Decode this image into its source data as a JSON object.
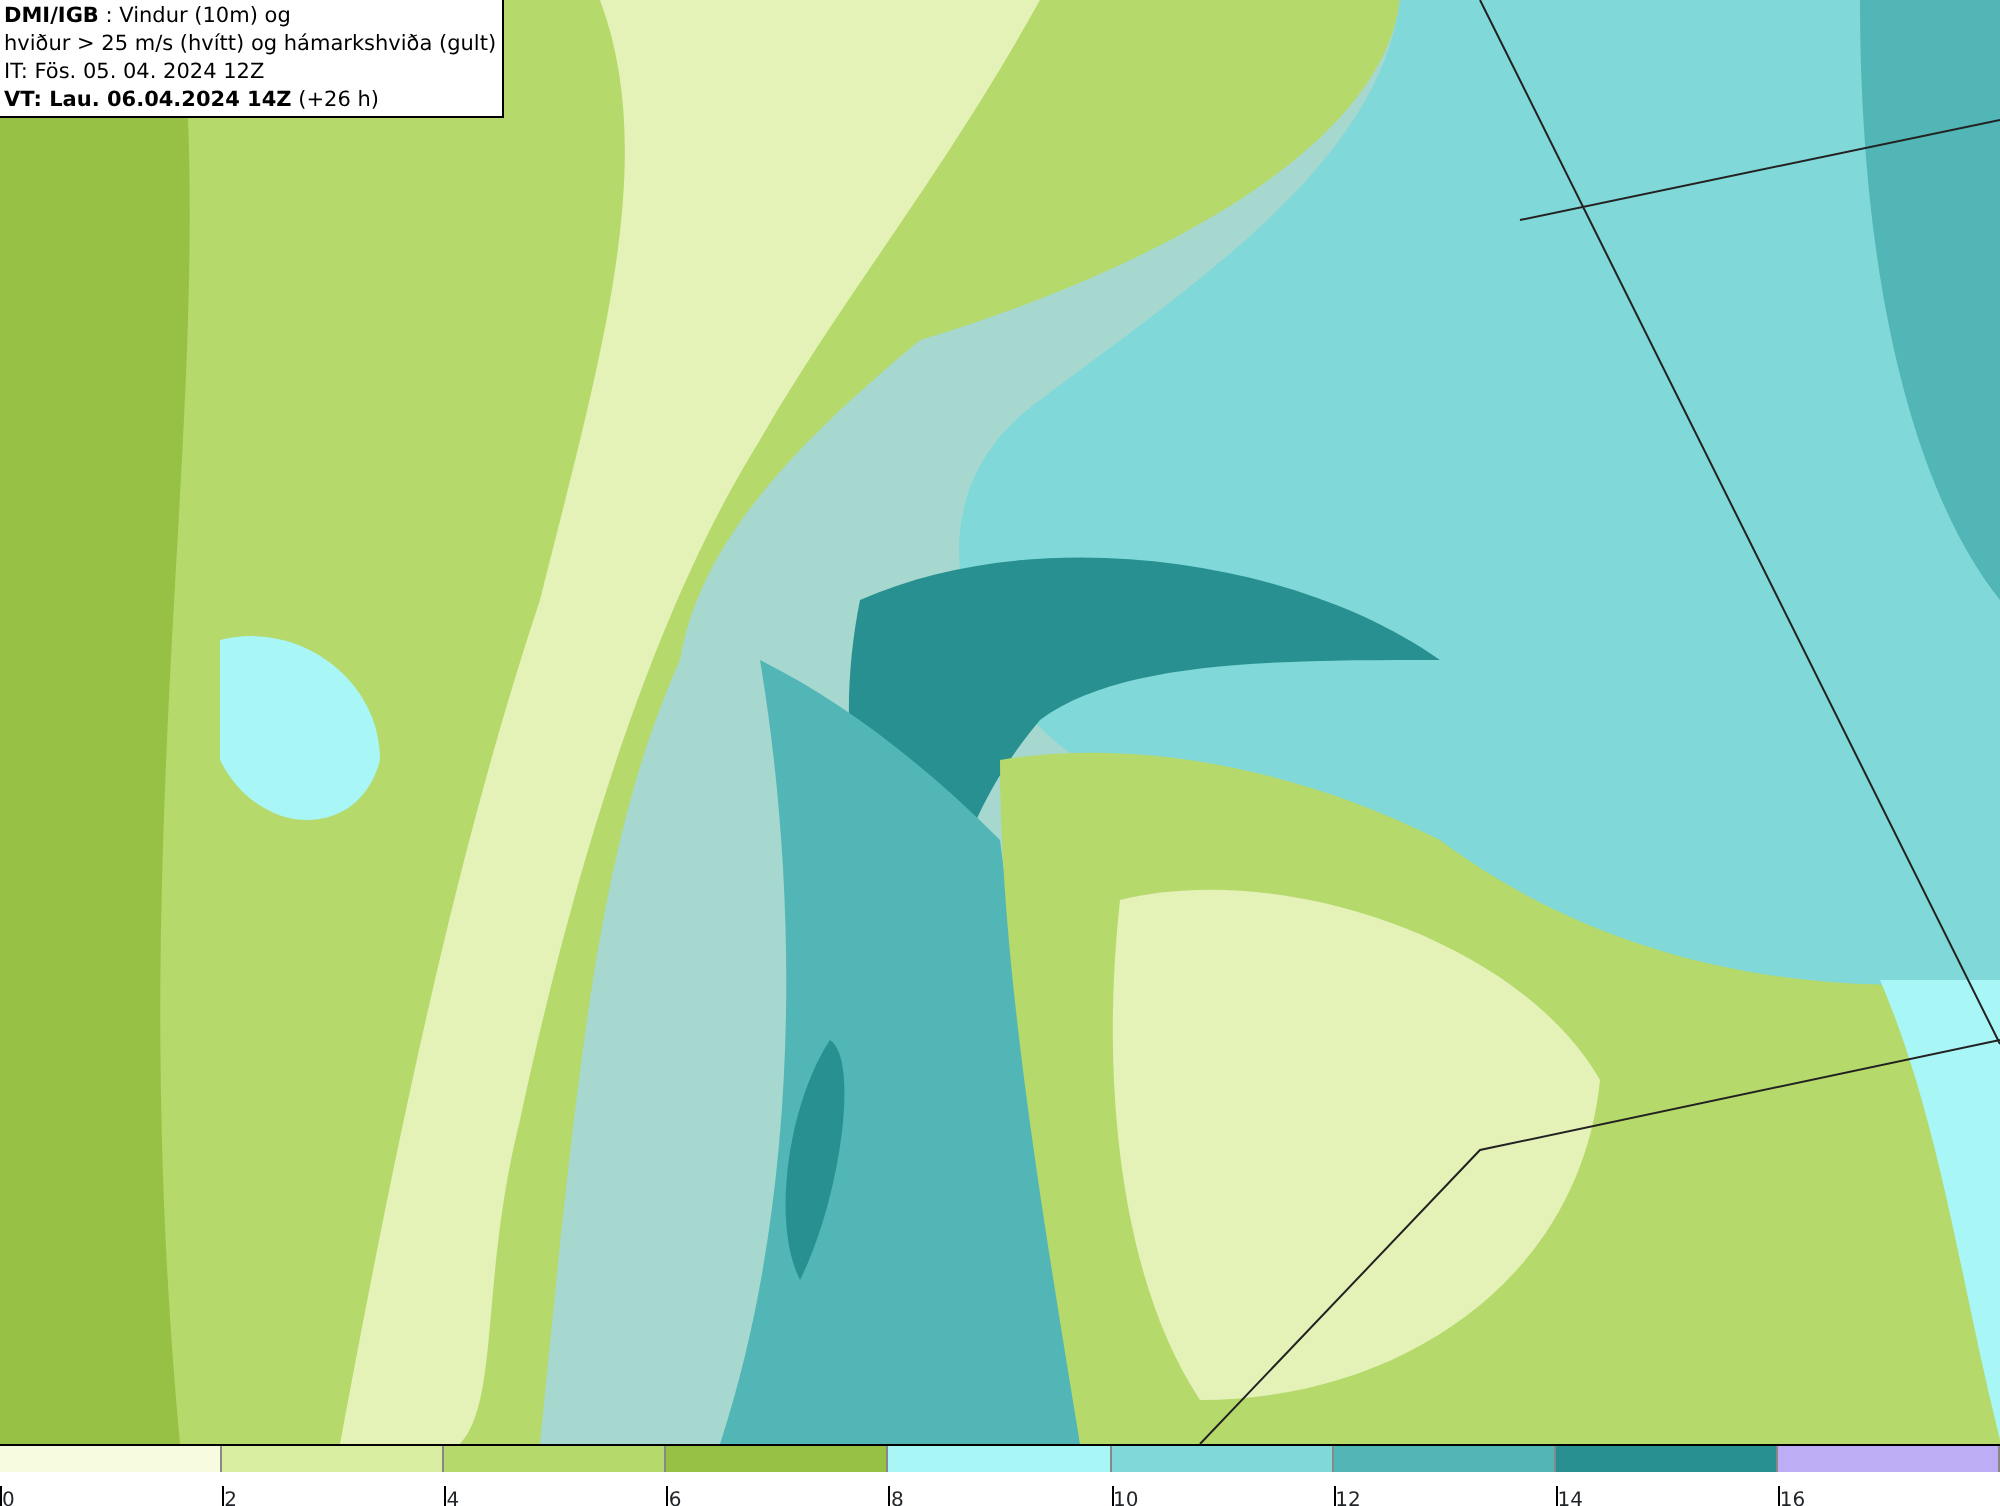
{
  "header": {
    "lines": [
      "**DMI/IGB** : Vindur (10m) og",
      "hviður > 25 m/s (hvítt) og hámarkshviða (gult)",
      "IT: Fös. 05. 04. 2024 12Z",
      "**VT: Lau. 06.04.2024 14Z** (+26 h)"
    ]
  },
  "legend": [
    {
      "label": "0",
      "color": "#f7fce0"
    },
    {
      "label": "2",
      "color": "#d8eda0"
    },
    {
      "label": "4",
      "color": "#b5d96a"
    },
    {
      "label": "6",
      "color": "#96c144"
    },
    {
      "label": "8",
      "color": "#a8f6f6"
    },
    {
      "label": "10",
      "color": "#80d8d8"
    },
    {
      "label": "12",
      "color": "#52b6b6"
    },
    {
      "label": "14",
      "color": "#289090"
    },
    {
      "label": "16",
      "color": "#bcadf5"
    }
  ]
}
